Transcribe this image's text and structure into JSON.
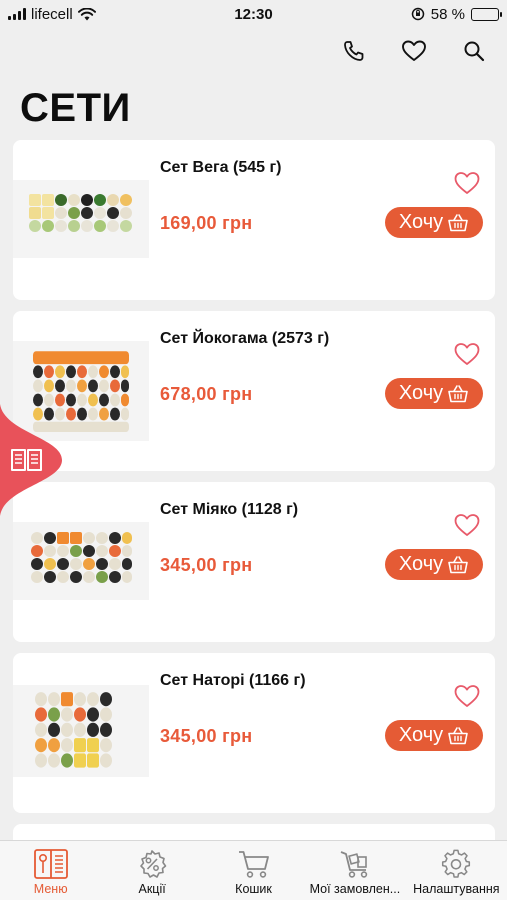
{
  "status": {
    "carrier": "lifecell",
    "time": "12:30",
    "battery": "58 %",
    "battery_level": 0.58
  },
  "header": {
    "title": "СЕТИ",
    "actions": [
      {
        "icon": "phone-icon"
      },
      {
        "icon": "heart-icon"
      },
      {
        "icon": "search-icon"
      }
    ]
  },
  "products": [
    {
      "name": "Сет Вега (545 г)",
      "price": "169,00 грн",
      "button": "Хочу"
    },
    {
      "name": "Сет Йокогама (2573 г)",
      "price": "678,00 грн",
      "button": "Хочу"
    },
    {
      "name": "Сет Міяко (1128 г)",
      "price": "345,00 грн",
      "button": "Хочу"
    },
    {
      "name": "Сет Наторі (1166 г)",
      "price": "345,00 грн",
      "button": "Хочу"
    }
  ],
  "tabs": [
    {
      "label": "Меню",
      "icon": "menu-book-icon",
      "active": true
    },
    {
      "label": "Акції",
      "icon": "discount-icon",
      "active": false
    },
    {
      "label": "Кошик",
      "icon": "cart-icon",
      "active": false
    },
    {
      "label": "Мої замовлен...",
      "icon": "orders-cart-icon",
      "active": false
    },
    {
      "label": "Налаштування",
      "icon": "gear-icon",
      "active": false
    }
  ],
  "colors": {
    "accent": "#e55b35",
    "price": "#e85a3a",
    "background": "#efefef",
    "card": "#ffffff"
  }
}
